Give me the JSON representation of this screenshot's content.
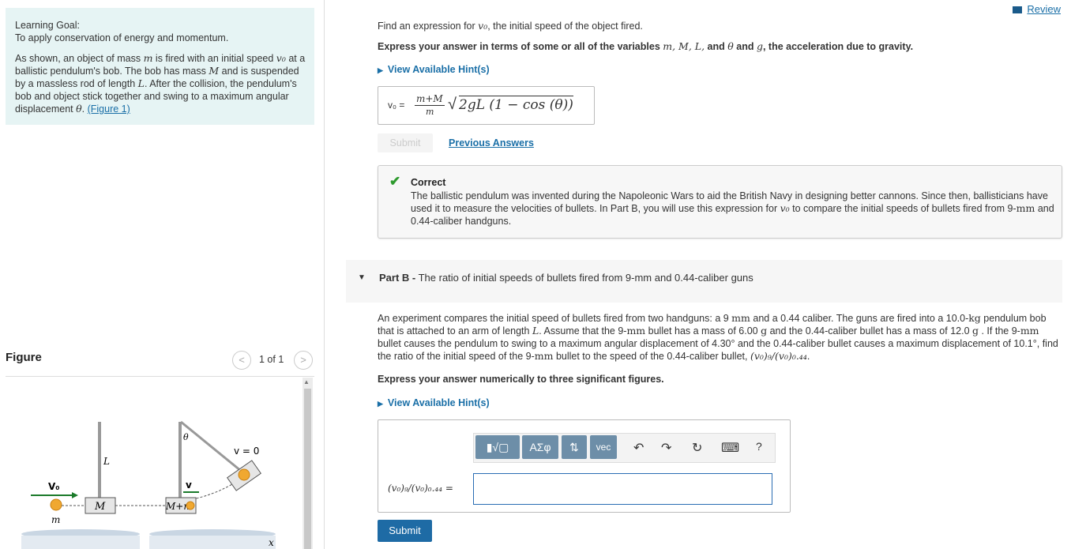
{
  "left": {
    "goal_title": "Learning Goal:",
    "goal_subtitle": "To apply conservation of energy and momentum.",
    "desc_part1": "As shown, an object of mass ",
    "desc_m": "m",
    "desc_part2": " is fired with an initial speed ",
    "desc_v0": "v₀",
    "desc_part3": " at a ballistic pendulum's bob. The bob has mass ",
    "desc_M": "M",
    "desc_part4": " and is suspended by a massless rod of length ",
    "desc_L": "L",
    "desc_part5": ". After the collision, the pendulum's bob and object stick together and swing to a maximum angular displacement ",
    "desc_theta": "θ",
    "desc_part6": ". ",
    "figure_link": "(Figure 1)",
    "figure_label": "Figure",
    "figure_pager": "1 of 1",
    "figure": {
      "v0": "V₀",
      "m": "m",
      "M": "M",
      "L": "L",
      "theta": "θ",
      "v": "v",
      "Mm": "M+m",
      "v_zero": "v = 0",
      "x": "x"
    }
  },
  "review_label": "Review",
  "part_a": {
    "question_1": "Find an expression for ",
    "question_v0": "v₀",
    "question_2": ", the initial speed of the object fired.",
    "instruction_1": "Express your answer in terms of some or all of the variables ",
    "instruction_vars": "m, M, L,",
    "instruction_2": " and ",
    "instruction_theta": "θ",
    "instruction_3": " and ",
    "instruction_g": "g",
    "instruction_4": ", the acceleration due to gravity.",
    "hint_label": "View Available Hint(s)",
    "answer_lhs": "v₀ =",
    "answer_num": "m+M",
    "answer_den": "m",
    "answer_sqrt": "2gL (1 − cos (θ))",
    "submit_label": "Submit",
    "prev_answers": "Previous Answers",
    "correct_title": "Correct",
    "correct_body_1": "The ballistic pendulum was invented during the Napoleonic Wars to aid the British Navy in designing better cannons. Since then, ballisticians have used it to measure the velocities of bullets. In Part B, you will use this expression for ",
    "correct_v0": "v₀",
    "correct_body_2": " to compare the initial speeds of bullets fired from 9-",
    "correct_mm": "mm",
    "correct_body_3": " and 0.44-caliber handguns."
  },
  "part_b": {
    "label": "Part B -",
    "title": " The ratio of initial speeds of bullets fired from 9-mm and 0.44-caliber guns",
    "body_1": "An experiment compares the initial speed of bullets fired from two handguns: a 9 ",
    "mm": "mm",
    "body_2": " and a 0.44 caliber. The guns are fired into a 10.0-",
    "kg": "kg",
    "body_3": " pendulum bob that is attached to an arm of length ",
    "L": "L",
    "body_4": ". Assume that the 9-",
    "body_5": " bullet has a mass of 6.00 ",
    "g": "g",
    "body_6": " and the 0.44-caliber bullet has a mass of 12.0 ",
    "body_7": " . If the 9-",
    "body_8": " bullet causes the pendulum to swing to a maximum angular displacement of 4.30° and the 0.44-caliber bullet causes a maximum displacement of 10.1°, find the ratio of the initial speed of the 9-",
    "body_9": " bullet to the speed of the 0.44-caliber bullet, ",
    "ratio_expr": "(v₀)₉/(v₀)₀.₄₄",
    "body_10": ".",
    "instruction": "Express your answer numerically to three significant figures.",
    "hint_label": "View Available Hint(s)",
    "toolbar_templates": "▮√▢",
    "toolbar_greek": "ΑΣφ",
    "toolbar_arrows": "⇅",
    "toolbar_vec": "vec",
    "undo_icon": "↶",
    "redo_icon": "↷",
    "reset_icon": "↻",
    "keyboard_icon": "⌨",
    "help_icon": "?",
    "input_label": "(v₀)₉/(v₀)₀.₄₄ =",
    "input_value": "",
    "submit_label": "Submit"
  }
}
